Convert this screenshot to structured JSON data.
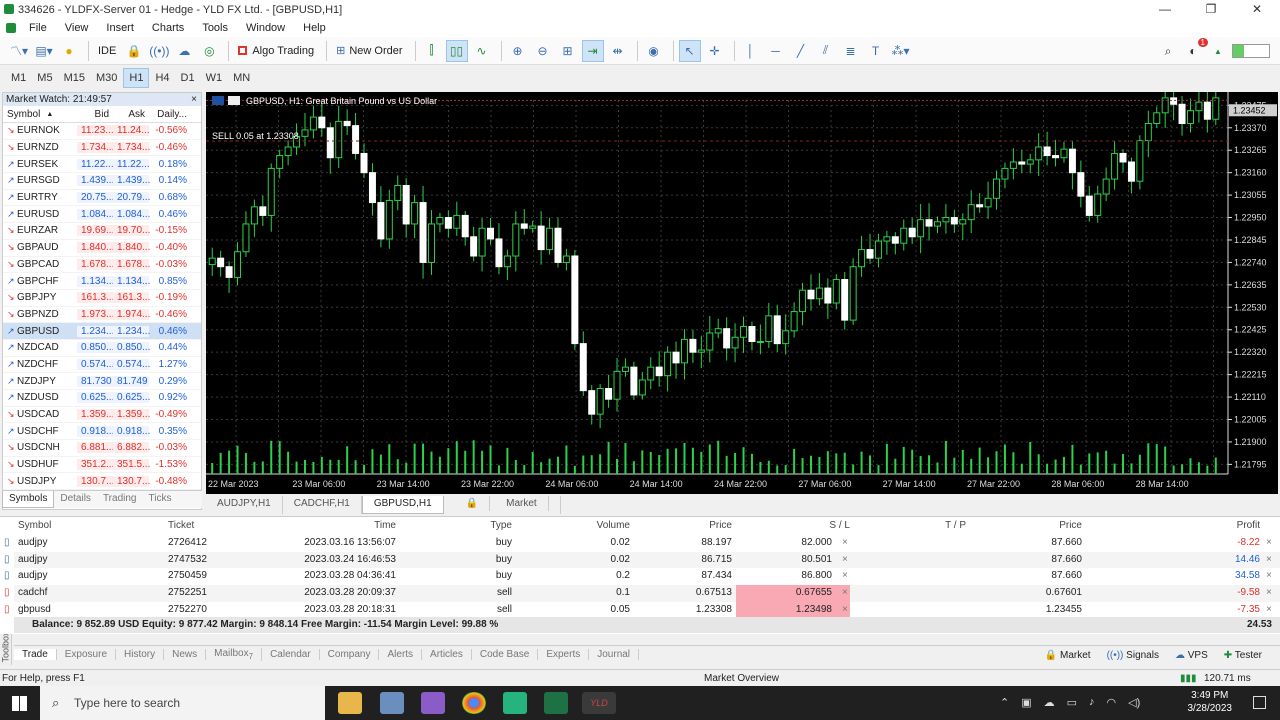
{
  "window": {
    "title": "334626 - YLDFX-Server 01 - Hedge - YLD FX Ltd. - [GBPUSD,H1]",
    "minimize": "—",
    "restore": "❐",
    "close": "✕"
  },
  "menu": [
    "File",
    "View",
    "Insert",
    "Charts",
    "Tools",
    "Window",
    "Help"
  ],
  "toolbar": {
    "ide": "IDE",
    "algo": "Algo Trading",
    "new_order": "New Order",
    "alert_count": "1"
  },
  "timeframes": [
    "M1",
    "M5",
    "M15",
    "M30",
    "H1",
    "H4",
    "D1",
    "W1",
    "MN"
  ],
  "active_timeframe": "H1",
  "market_watch": {
    "title": "Market Watch: 21:49:57",
    "close": "×",
    "headers": {
      "symbol": "Symbol",
      "bid": "Bid",
      "ask": "Ask",
      "daily": "Daily..."
    },
    "rows": [
      {
        "s": "EURNOK",
        "b": "11.23...",
        "a": "11.24...",
        "d": "-0.56%",
        "dir": "dn"
      },
      {
        "s": "EURNZD",
        "b": "1.734...",
        "a": "1.734...",
        "d": "-0.46%",
        "dir": "dn"
      },
      {
        "s": "EURSEK",
        "b": "11.22...",
        "a": "11.22...",
        "d": "0.18%",
        "dir": "up"
      },
      {
        "s": "EURSGD",
        "b": "1.439...",
        "a": "1.439...",
        "d": "0.14%",
        "dir": "up"
      },
      {
        "s": "EURTRY",
        "b": "20.75...",
        "a": "20.79...",
        "d": "0.68%",
        "dir": "up"
      },
      {
        "s": "EURUSD",
        "b": "1.084...",
        "a": "1.084...",
        "d": "0.46%",
        "dir": "up"
      },
      {
        "s": "EURZAR",
        "b": "19.69...",
        "a": "19.70...",
        "d": "-0.15%",
        "dir": "dn"
      },
      {
        "s": "GBPAUD",
        "b": "1.840...",
        "a": "1.840...",
        "d": "-0.40%",
        "dir": "dn"
      },
      {
        "s": "GBPCAD",
        "b": "1.678...",
        "a": "1.678...",
        "d": "-0.03%",
        "dir": "dn"
      },
      {
        "s": "GBPCHF",
        "b": "1.134...",
        "a": "1.134...",
        "d": "0.85%",
        "dir": "up"
      },
      {
        "s": "GBPJPY",
        "b": "161.3...",
        "a": "161.3...",
        "d": "-0.19%",
        "dir": "dn"
      },
      {
        "s": "GBPNZD",
        "b": "1.973...",
        "a": "1.974...",
        "d": "-0.46%",
        "dir": "dn"
      },
      {
        "s": "GBPUSD",
        "b": "1.234...",
        "a": "1.234...",
        "d": "0.46%",
        "dir": "up",
        "sel": true
      },
      {
        "s": "NZDCAD",
        "b": "0.850...",
        "a": "0.850...",
        "d": "0.44%",
        "dir": "up"
      },
      {
        "s": "NZDCHF",
        "b": "0.574...",
        "a": "0.574...",
        "d": "1.27%",
        "dir": "up"
      },
      {
        "s": "NZDJPY",
        "b": "81.730",
        "a": "81.749",
        "d": "0.29%",
        "dir": "up"
      },
      {
        "s": "NZDUSD",
        "b": "0.625...",
        "a": "0.625...",
        "d": "0.92%",
        "dir": "up"
      },
      {
        "s": "USDCAD",
        "b": "1.359...",
        "a": "1.359...",
        "d": "-0.49%",
        "dir": "dn"
      },
      {
        "s": "USDCHF",
        "b": "0.918...",
        "a": "0.918...",
        "d": "0.35%",
        "dir": "up"
      },
      {
        "s": "USDCNH",
        "b": "6.881...",
        "a": "6.882...",
        "d": "-0.03%",
        "dir": "dn"
      },
      {
        "s": "USDHUF",
        "b": "351.2...",
        "a": "351.5...",
        "d": "-1.53%",
        "dir": "dn"
      },
      {
        "s": "USDJPY",
        "b": "130.7...",
        "a": "130.7...",
        "d": "-0.48%",
        "dir": "dn"
      }
    ],
    "tabs": [
      "Symbols",
      "Details",
      "Trading",
      "Ticks"
    ]
  },
  "chart_data": {
    "type": "candlestick",
    "title": "GBPUSD, H1:  Great Britain Pound vs US Dollar",
    "trade_label": "SELL 0.05 at 1.23308",
    "current_price": "1.23452",
    "y_ticks": [
      "1.23475",
      "1.23370",
      "1.23265",
      "1.23160",
      "1.23055",
      "1.22950",
      "1.22845",
      "1.22740",
      "1.22635",
      "1.22530",
      "1.22425",
      "1.22320",
      "1.22215",
      "1.22110",
      "1.22005",
      "1.21900",
      "1.21795"
    ],
    "ylim": [
      1.2175,
      1.235
    ],
    "x_ticks": [
      "22 Mar 2023",
      "23 Mar 06:00",
      "23 Mar 14:00",
      "23 Mar 22:00",
      "24 Mar 06:00",
      "24 Mar 14:00",
      "24 Mar 22:00",
      "27 Mar 06:00",
      "27 Mar 14:00",
      "27 Mar 22:00",
      "28 Mar 06:00",
      "28 Mar 14:00"
    ],
    "close": [
      1.2276,
      1.2272,
      1.2267,
      1.2279,
      1.2292,
      1.23,
      1.2296,
      1.2318,
      1.2324,
      1.2328,
      1.2333,
      1.2336,
      1.2342,
      1.2337,
      1.2323,
      1.234,
      1.2338,
      1.2325,
      1.2316,
      1.2302,
      1.2285,
      1.2303,
      1.231,
      1.2292,
      1.2302,
      1.2274,
      1.2292,
      1.2295,
      1.229,
      1.2296,
      1.2286,
      1.2277,
      1.229,
      1.2285,
      1.2272,
      1.2277,
      1.2292,
      1.229,
      1.2291,
      1.228,
      1.229,
      1.2274,
      1.2277,
      1.2236,
      1.2214,
      1.2203,
      1.2215,
      1.221,
      1.2223,
      1.2225,
      1.2212,
      1.2219,
      1.2225,
      1.2221,
      1.2232,
      1.2227,
      1.2238,
      1.2232,
      1.2233,
      1.2241,
      1.2243,
      1.2234,
      1.2239,
      1.2244,
      1.2237,
      1.2237,
      1.2249,
      1.2236,
      1.2242,
      1.2251,
      1.2261,
      1.2257,
      1.2262,
      1.2255,
      1.2266,
      1.2247,
      1.2272,
      1.228,
      1.2276,
      1.2284,
      1.2286,
      1.2283,
      1.229,
      1.2286,
      1.2294,
      1.2291,
      1.2293,
      1.2295,
      1.2292,
      1.2294,
      1.2301,
      1.23,
      1.2304,
      1.2313,
      1.2318,
      1.2321,
      1.232,
      1.2322,
      1.2328,
      1.2324,
      1.2323,
      1.2327,
      1.2316,
      1.2305,
      1.2296,
      1.2306,
      1.2313,
      1.2325,
      1.2321,
      1.2312,
      1.2331,
      1.2339,
      1.2344,
      1.2351,
      1.2348,
      1.2339,
      1.2345,
      1.2349,
      1.2341,
      1.2351
    ]
  },
  "chart_tabs": [
    "AUDJPY,H1",
    "CADCHF,H1",
    "GBPUSD,H1",
    "Market"
  ],
  "active_chart_tab": "GBPUSD,H1",
  "trade_table": {
    "headers": {
      "symbol": "Symbol",
      "ticket": "Ticket",
      "time": "Time",
      "type": "Type",
      "volume": "Volume",
      "price": "Price",
      "sl": "S / L",
      "tp": "T / P",
      "price2": "Price",
      "profit": "Profit"
    },
    "rows": [
      {
        "symbol": "audjpy",
        "ticket": "2726412",
        "time": "2023.03.16 13:56:07",
        "type": "buy",
        "volume": "0.02",
        "price": "88.197",
        "sl": "82.000",
        "tp": "",
        "price2": "87.660",
        "profit": "-8.22",
        "pdir": "dn",
        "slhl": false
      },
      {
        "symbol": "audjpy",
        "ticket": "2747532",
        "time": "2023.03.24 16:46:53",
        "type": "buy",
        "volume": "0.02",
        "price": "86.715",
        "sl": "80.501",
        "tp": "",
        "price2": "87.660",
        "profit": "14.46",
        "pdir": "up",
        "slhl": false
      },
      {
        "symbol": "audjpy",
        "ticket": "2750459",
        "time": "2023.03.28 04:36:41",
        "type": "buy",
        "volume": "0.2",
        "price": "87.434",
        "sl": "86.800",
        "tp": "",
        "price2": "87.660",
        "profit": "34.58",
        "pdir": "up",
        "slhl": false
      },
      {
        "symbol": "cadchf",
        "ticket": "2752251",
        "time": "2023.03.28 20:09:37",
        "type": "sell",
        "volume": "0.1",
        "price": "0.67513",
        "sl": "0.67655",
        "tp": "",
        "price2": "0.67601",
        "profit": "-9.58",
        "pdir": "dn",
        "slhl": true
      },
      {
        "symbol": "gbpusd",
        "ticket": "2752270",
        "time": "2023.03.28 20:18:31",
        "type": "sell",
        "volume": "0.05",
        "price": "1.23308",
        "sl": "1.23498",
        "tp": "",
        "price2": "1.23455",
        "profit": "-7.35",
        "pdir": "dn",
        "slhl": true
      }
    ],
    "balance_line": "Balance: 9 852.89 USD  Equity: 9 877.42  Margin: 9 848.14  Free Margin: -11.54  Margin Level: 99.88 %",
    "total": "24.53"
  },
  "toolbox": {
    "label": "Toolbox",
    "tabs": [
      "Trade",
      "Exposure",
      "History",
      "News",
      "Mailbox",
      "Calendar",
      "Company",
      "Alerts",
      "Articles",
      "Code Base",
      "Experts",
      "Journal"
    ],
    "mailbox_count": "7",
    "right": [
      "Market",
      "Signals",
      "VPS",
      "Tester"
    ]
  },
  "status": {
    "help": "For Help, press F1",
    "middle": "Market Overview",
    "ping": "120.71 ms"
  },
  "taskbar": {
    "search": "Type here to search",
    "time": "3:49 PM",
    "date": "3/28/2023"
  }
}
